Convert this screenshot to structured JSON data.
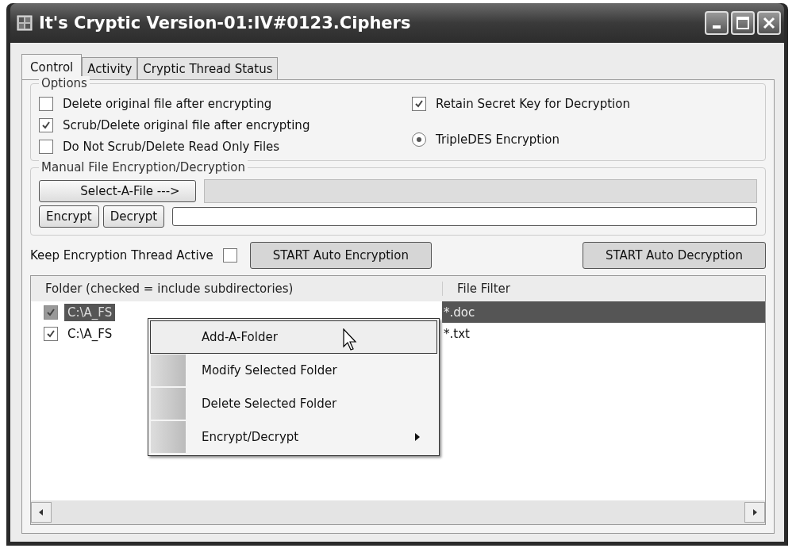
{
  "window": {
    "title": "It's Cryptic Version-01:IV#0123.Ciphers"
  },
  "tabs": [
    {
      "label": "Control",
      "selected": true
    },
    {
      "label": "Activity",
      "selected": false
    },
    {
      "label": "Cryptic Thread Status",
      "selected": false
    }
  ],
  "options": {
    "title": "Options",
    "left": [
      {
        "label": "Delete original file after encrypting",
        "checked": false
      },
      {
        "label": "Scrub/Delete original file after encrypting",
        "checked": true
      },
      {
        "label": "Do Not Scrub/Delete Read Only Files",
        "checked": false
      }
    ],
    "retain": {
      "label": "Retain Secret Key for Decryption",
      "checked": true
    },
    "radio": {
      "label": "TripleDES Encryption",
      "selected": true
    }
  },
  "manual": {
    "title": "Manual File Encryption/Decryption",
    "select_button": "Select-A-File --->",
    "encrypt_button": "Encrypt",
    "decrypt_button": "Decrypt",
    "progress": {
      "level": 0
    }
  },
  "keep_thread": {
    "label": "Keep Encryption Thread Active",
    "checked": false
  },
  "auto_buttons": [
    "START Auto Encryption",
    "START Auto Decryption"
  ],
  "folder_list": {
    "columns": [
      "Folder (checked = include subdirectories)",
      "File Filter"
    ],
    "rows": [
      {
        "folder": "C:\\A_FS",
        "filter": "*.doc",
        "checked": true,
        "selected": true
      },
      {
        "folder": "C:\\A_FS",
        "filter": "*.txt",
        "checked": true,
        "selected": false
      }
    ]
  },
  "context_menu": [
    {
      "label": "Add-A-Folder",
      "highlighted": true,
      "kind": "item"
    },
    {
      "label": "Modify Selected Folder",
      "highlighted": false,
      "kind": "item"
    },
    {
      "label": "Delete Selected Folder",
      "highlighted": false,
      "kind": "item"
    },
    {
      "label": "Encrypt/Decrypt",
      "highlighted": false,
      "kind": "submenu"
    }
  ]
}
